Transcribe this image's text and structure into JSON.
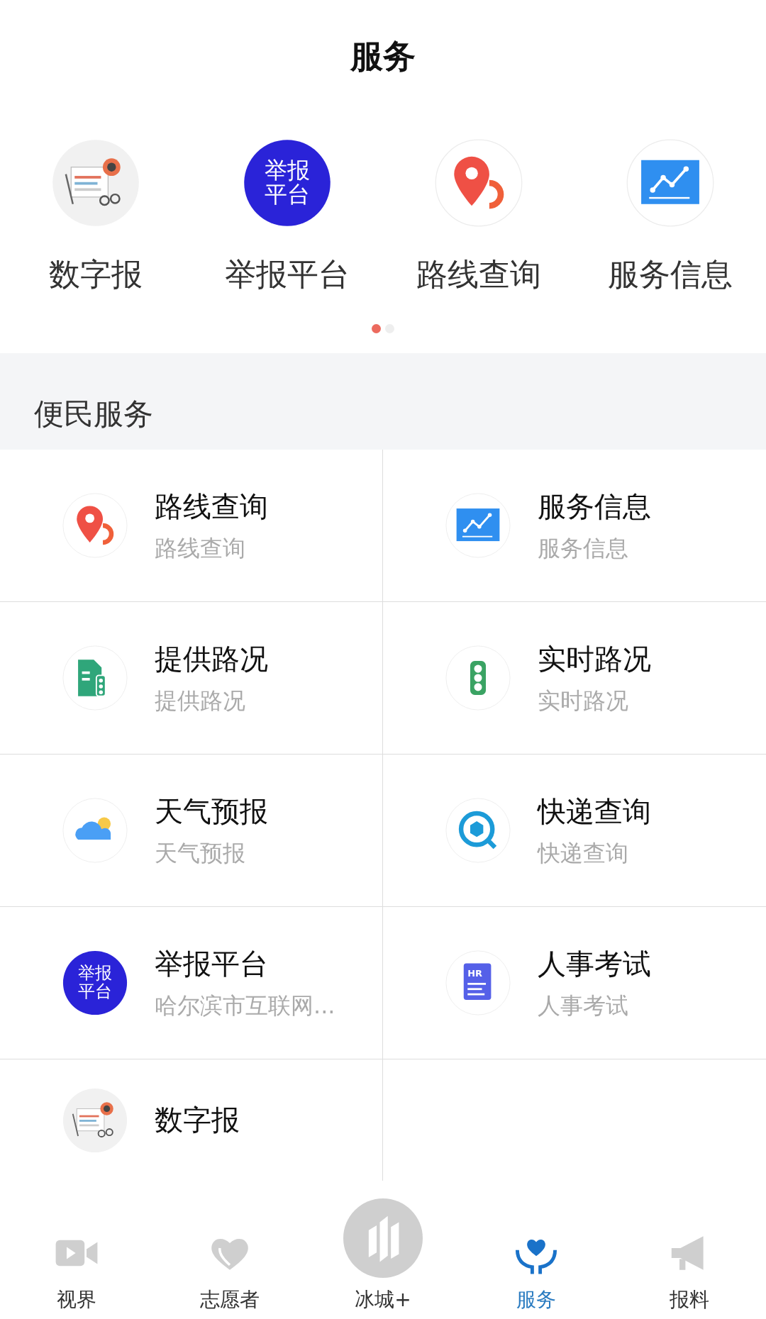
{
  "header": {
    "title": "服务"
  },
  "quick_links": [
    {
      "label": "数字报",
      "kind": "news"
    },
    {
      "label": "举报平台",
      "kind": "report",
      "icon_text": [
        "举报",
        "平台"
      ]
    },
    {
      "label": "路线查询",
      "kind": "route"
    },
    {
      "label": "服务信息",
      "kind": "chart"
    }
  ],
  "pager": [
    {
      "selected": true
    },
    {
      "selected": false
    }
  ],
  "section": {
    "title": "便民服务"
  },
  "services": [
    {
      "title": "路线查询",
      "subtitle": "路线查询",
      "kind": "route"
    },
    {
      "title": "服务信息",
      "subtitle": "服务信息",
      "kind": "chart"
    },
    {
      "title": "提供路况",
      "subtitle": "提供路况",
      "kind": "document"
    },
    {
      "title": "实时路况",
      "subtitle": "实时路况",
      "kind": "signal"
    },
    {
      "title": "天气预报",
      "subtitle": "天气预报",
      "kind": "weather"
    },
    {
      "title": "快递查询",
      "subtitle": "快递查询",
      "kind": "parcel"
    },
    {
      "title": "举报平台",
      "subtitle": "哈尔滨市互联网...",
      "kind": "report",
      "icon_text": [
        "举报",
        "平台"
      ]
    },
    {
      "title": "人事考试",
      "subtitle": "人事考试",
      "kind": "hr",
      "icon_text": [
        "HR"
      ]
    },
    {
      "title": "数字报",
      "kind": "news"
    }
  ],
  "tabs": [
    {
      "label": "视界",
      "kind": "video",
      "selected": false
    },
    {
      "label": "志愿者",
      "kind": "heart",
      "selected": false
    },
    {
      "label": "冰城+",
      "kind": "city",
      "selected": false
    },
    {
      "label": "服务",
      "kind": "care",
      "selected": true
    },
    {
      "label": "报料",
      "kind": "megaphone",
      "selected": false
    }
  ]
}
